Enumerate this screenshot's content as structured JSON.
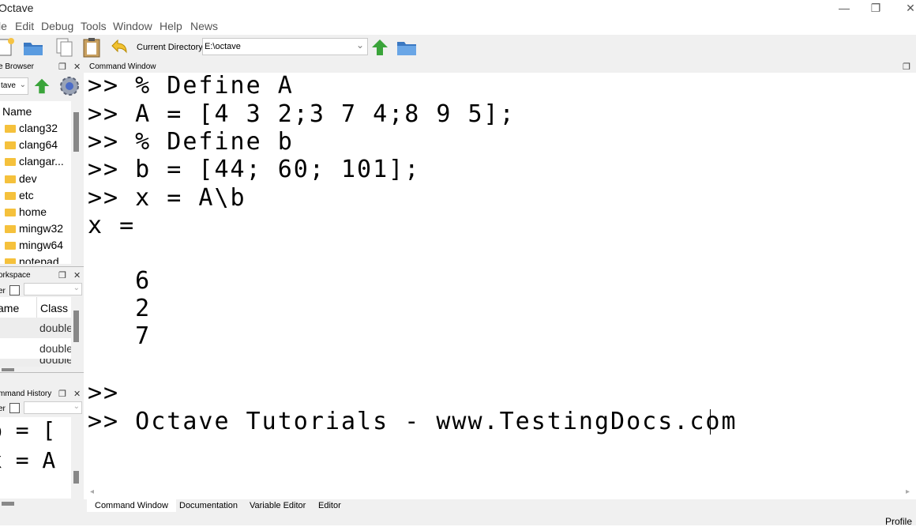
{
  "window": {
    "title": "Octave"
  },
  "menu": [
    "le",
    "Edit",
    "Debug",
    "Tools",
    "Window",
    "Help",
    "News"
  ],
  "toolbar": {
    "current_dir_label": "Current Directory:",
    "current_dir_value": "E:\\octave"
  },
  "file_browser": {
    "title": "e Browser",
    "path_value": "tave",
    "column_header": "Name",
    "items": [
      "clang32",
      "clang64",
      "clangar...",
      "dev",
      "etc",
      "home",
      "mingw32",
      "mingw64",
      "notepad"
    ]
  },
  "workspace": {
    "title": "orkspace",
    "filter_label": "er",
    "columns": [
      "ame",
      "Class"
    ],
    "rows": [
      "double",
      "double",
      "double"
    ]
  },
  "command_history": {
    "title": "mmand History",
    "filter_label": "er",
    "lines": [
      "b = [",
      "x = A"
    ]
  },
  "command_window": {
    "title": "Command Window",
    "lines": [
      ">> % Define A",
      ">> A = [4 3 2;3 7 4;8 9 5];",
      ">> % Define b",
      ">> b = [44; 60; 101];",
      ">> x = A\\b",
      "x =",
      "   6",
      "   2",
      "   7",
      ">>",
      ">> Octave Tutorials - www.TestingDocs.com"
    ]
  },
  "tabs": [
    "Command Window",
    "Documentation",
    "Variable Editor",
    "Editor"
  ],
  "status": {
    "profiler": "Profile"
  },
  "colors": {
    "toolbar_bg": "#f0f0f0",
    "folder": "#f5c13c",
    "arrow_green": "#3aa43a"
  }
}
